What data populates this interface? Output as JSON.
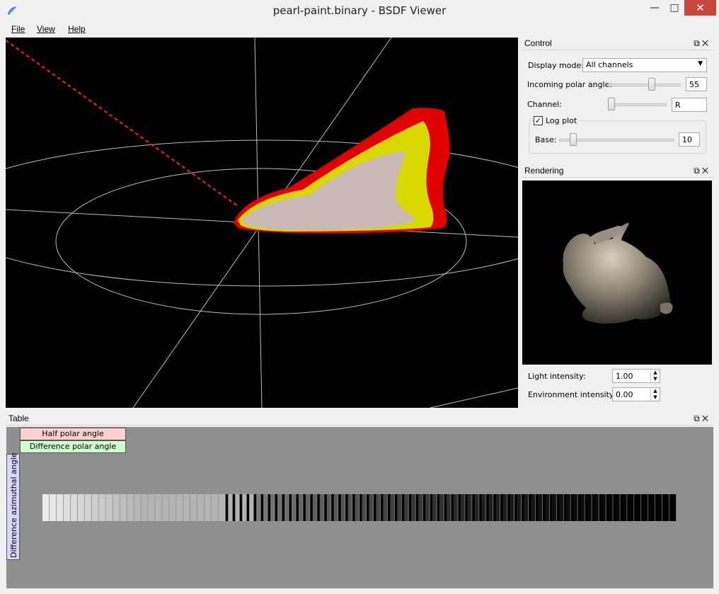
{
  "window": {
    "title": "pearl-paint.binary - BSDF Viewer",
    "min_glyph": "—",
    "max_glyph": "□",
    "close_glyph": "✕"
  },
  "menu": [
    {
      "label": "File"
    },
    {
      "label": "View"
    },
    {
      "label": "Help"
    }
  ],
  "control": {
    "title": "Control",
    "display_mode_label": "Display mode:",
    "display_mode_value": "All channels",
    "incoming_polar_label": "Incoming polar angle:",
    "incoming_polar_value": "55",
    "incoming_polar_fraction": 0.61,
    "channel_label": "Channel:",
    "channel_value": "R",
    "channel_fraction": 0.0,
    "log_plot_label": "Log plot",
    "log_plot_checked": true,
    "base_label": "Base:",
    "base_value": "10",
    "base_fraction": 0.1
  },
  "rendering": {
    "title": "Rendering",
    "light_label": "Light intensity:",
    "light_value": "1.00",
    "env_label": "Environment intensity:",
    "env_value": "0.00"
  },
  "table": {
    "title": "Table",
    "half_polar_label": "Half polar angle",
    "diff_polar_label": "Difference polar angle",
    "diff_azimuthal_label": "Difference azimuthal angle"
  },
  "colors": {
    "lobe_red": "#e00000",
    "lobe_yellow": "#d8d800",
    "lobe_white": "#c8b8c0",
    "grid": "#bcbcbc",
    "incident": "#ff2020",
    "half_tag": "#ffd0d0",
    "diff_tag": "#d0ffd0",
    "azim_tag": "#d8d8ff"
  }
}
